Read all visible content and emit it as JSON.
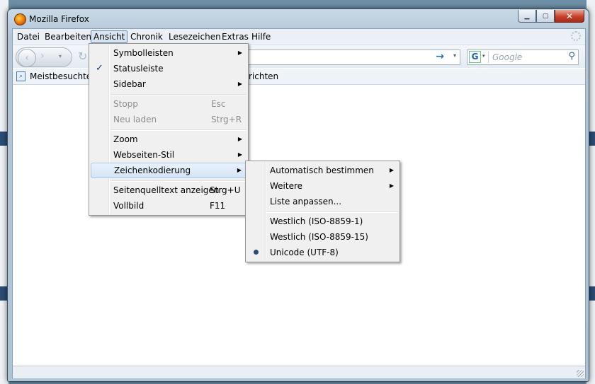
{
  "window": {
    "title": "Mozilla Firefox"
  },
  "menubar": {
    "items": [
      "Datei",
      "Bearbeiten",
      "Ansicht",
      "Chronik",
      "Lesezeichen",
      "Extras",
      "Hilfe"
    ]
  },
  "search": {
    "placeholder": "Google",
    "engine_icon": "G"
  },
  "bookmarks": {
    "item": "Meistbesuchte S",
    "item2": "richten"
  },
  "ansicht_menu": {
    "items": [
      {
        "label": "Symbolleisten",
        "submenu": true
      },
      {
        "label": "Statusleiste",
        "checked": true
      },
      {
        "label": "Sidebar",
        "submenu": true
      },
      {
        "label": "Stopp",
        "accel": "Esc",
        "disabled": true
      },
      {
        "label": "Neu laden",
        "accel": "Strg+R",
        "disabled": true
      },
      {
        "label": "Zoom",
        "submenu": true
      },
      {
        "label": "Webseiten-Stil",
        "submenu": true
      },
      {
        "label": "Zeichenkodierung",
        "submenu": true,
        "highlighted": true
      },
      {
        "label": "Seitenquelltext anzeigen",
        "accel": "Strg+U"
      },
      {
        "label": "Vollbild",
        "accel": "F11"
      }
    ]
  },
  "encoding_menu": {
    "items": [
      {
        "label": "Automatisch bestimmen",
        "submenu": true
      },
      {
        "label": "Weitere",
        "submenu": true
      },
      {
        "label": "Liste anpassen..."
      },
      {
        "label": "Westlich (ISO-8859-1)"
      },
      {
        "label": "Westlich (ISO-8859-15)"
      },
      {
        "label": "Unicode (UTF-8)",
        "selected": true
      }
    ]
  },
  "colors": {
    "menu_highlight": "#d4e4f6",
    "window_frame": "#b2c6d6",
    "close_button": "#c8422b"
  },
  "icons": {
    "submenu_arrow": "▶",
    "check": "✓",
    "go": "→",
    "magnifier": "⚲",
    "back": "‹",
    "forward": "›",
    "reload": "↻",
    "dropdown": "▾"
  }
}
